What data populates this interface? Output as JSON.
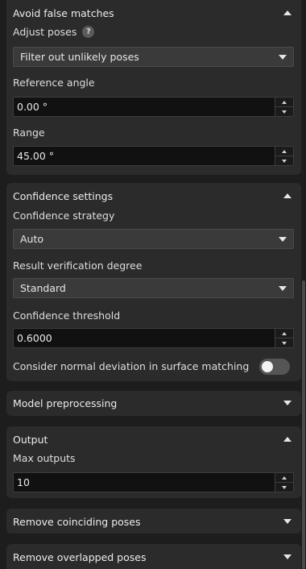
{
  "avoid": {
    "title": "Avoid false matches",
    "adjust_label": "Adjust poses",
    "help_glyph": "?",
    "adjust_value": "Filter out unlikely poses",
    "ref_label": "Reference angle",
    "ref_value": "0.00 °",
    "range_label": "Range",
    "range_value": "45.00 °"
  },
  "confidence": {
    "title": "Confidence settings",
    "strategy_label": "Confidence strategy",
    "strategy_value": "Auto",
    "verify_label": "Result verification degree",
    "verify_value": "Standard",
    "threshold_label": "Confidence threshold",
    "threshold_value": "0.6000",
    "normal_label": "Consider normal deviation in surface matching",
    "normal_enabled": false
  },
  "model": {
    "title": "Model preprocessing"
  },
  "output": {
    "title": "Output",
    "max_label": "Max outputs",
    "max_value": "10"
  },
  "coinciding": {
    "title": "Remove coinciding poses"
  },
  "overlapped": {
    "title": "Remove overlapped poses"
  }
}
